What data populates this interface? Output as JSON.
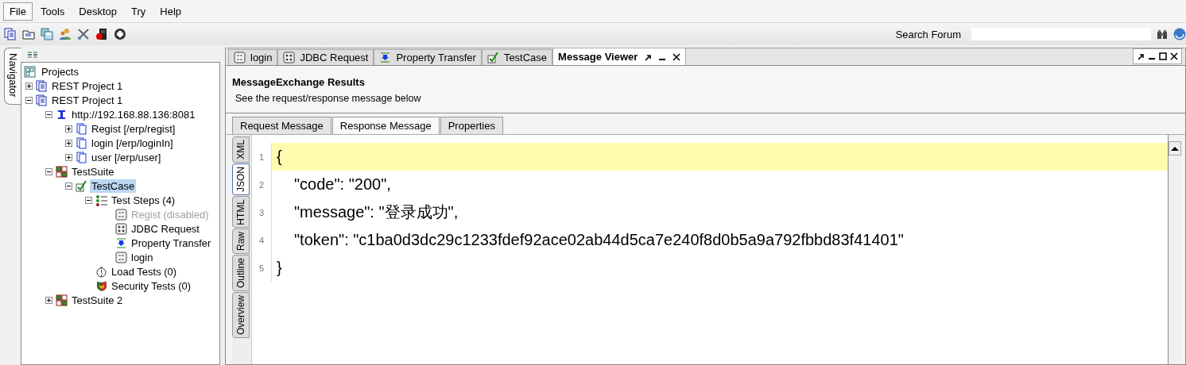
{
  "menu": [
    {
      "label": "File",
      "selected": true
    },
    {
      "label": "Tools",
      "selected": false
    },
    {
      "label": "Desktop",
      "selected": false
    },
    {
      "label": "Try",
      "selected": false
    },
    {
      "label": "Help",
      "selected": false
    }
  ],
  "toolbar": {
    "search_label": "Search Forum"
  },
  "navigator": {
    "tab": "Navigator",
    "root": "Projects",
    "items": [
      {
        "label": "REST Project 1",
        "kind": "project",
        "expanded": false,
        "selected": false
      },
      {
        "label": "REST Project 1",
        "kind": "project",
        "expanded": true,
        "selected": false,
        "children": [
          {
            "label": "http://192.168.88.136:8081",
            "kind": "endpoint",
            "expanded": true,
            "selected": false,
            "children": [
              {
                "label": "Regist [/erp/regist]",
                "kind": "resource",
                "expanded": false,
                "selected": false
              },
              {
                "label": "login [/erp/loginIn]",
                "kind": "resource",
                "expanded": false,
                "selected": false
              },
              {
                "label": "user [/erp/user]",
                "kind": "resource",
                "expanded": false,
                "selected": false
              }
            ]
          },
          {
            "label": "TestSuite",
            "kind": "suite",
            "expanded": true,
            "selected": false,
            "children": [
              {
                "label": "TestCase",
                "kind": "testcase",
                "expanded": true,
                "selected": true,
                "children": [
                  {
                    "label": "Test Steps (4)",
                    "kind": "steps",
                    "expanded": true,
                    "selected": false,
                    "children": [
                      {
                        "label": "Regist (disabled)",
                        "kind": "rest",
                        "selected": false,
                        "disabled": true
                      },
                      {
                        "label": "JDBC Request",
                        "kind": "jdbc",
                        "selected": false,
                        "disabled": false
                      },
                      {
                        "label": "Property Transfer",
                        "kind": "transfer",
                        "selected": false,
                        "disabled": false
                      },
                      {
                        "label": "login",
                        "kind": "rest",
                        "selected": false,
                        "disabled": false
                      }
                    ]
                  },
                  {
                    "label": "Load Tests (0)",
                    "kind": "load",
                    "selected": false
                  },
                  {
                    "label": "Security Tests (0)",
                    "kind": "security",
                    "selected": false
                  }
                ]
              }
            ]
          },
          {
            "label": "TestSuite 2",
            "kind": "suite",
            "expanded": false,
            "selected": false
          }
        ]
      }
    ]
  },
  "editor_tabs": [
    {
      "label": "login",
      "kind": "rest",
      "selected": false
    },
    {
      "label": "JDBC Request",
      "kind": "jdbc",
      "selected": false
    },
    {
      "label": "Property Transfer",
      "kind": "transfer",
      "selected": false
    },
    {
      "label": "TestCase",
      "kind": "testcase",
      "selected": false
    },
    {
      "label": "Message Viewer",
      "kind": "viewer",
      "selected": true
    }
  ],
  "viewer": {
    "title": "MessageExchange Results",
    "subtitle": "See the request/response message below",
    "message_tabs": [
      {
        "label": "Request Message",
        "selected": false
      },
      {
        "label": "Response Message",
        "selected": true
      },
      {
        "label": "Properties",
        "selected": false
      }
    ],
    "view_tabs": [
      {
        "label": "XML",
        "selected": false
      },
      {
        "label": "JSON",
        "selected": true
      },
      {
        "label": "HTML",
        "selected": false
      },
      {
        "label": "Raw",
        "selected": false
      },
      {
        "label": "Outline",
        "selected": false
      },
      {
        "label": "Overview",
        "selected": false
      }
    ],
    "lines": [
      {
        "number": "1",
        "text": "{",
        "indented": false,
        "highlighted": true
      },
      {
        "number": "2",
        "text": "\"code\": \"200\",",
        "indented": true,
        "highlighted": false
      },
      {
        "number": "3",
        "text": "\"message\": \"登录成功\",",
        "indented": true,
        "highlighted": false
      },
      {
        "number": "4",
        "text": "\"token\": \"c1ba0d3dc29c1233fdef92ace02ab44d5ca7e240f8d0b5a9a792fbbd83f41401\"",
        "indented": true,
        "highlighted": false
      },
      {
        "number": "5",
        "text": "}",
        "indented": false,
        "highlighted": false
      }
    ]
  }
}
